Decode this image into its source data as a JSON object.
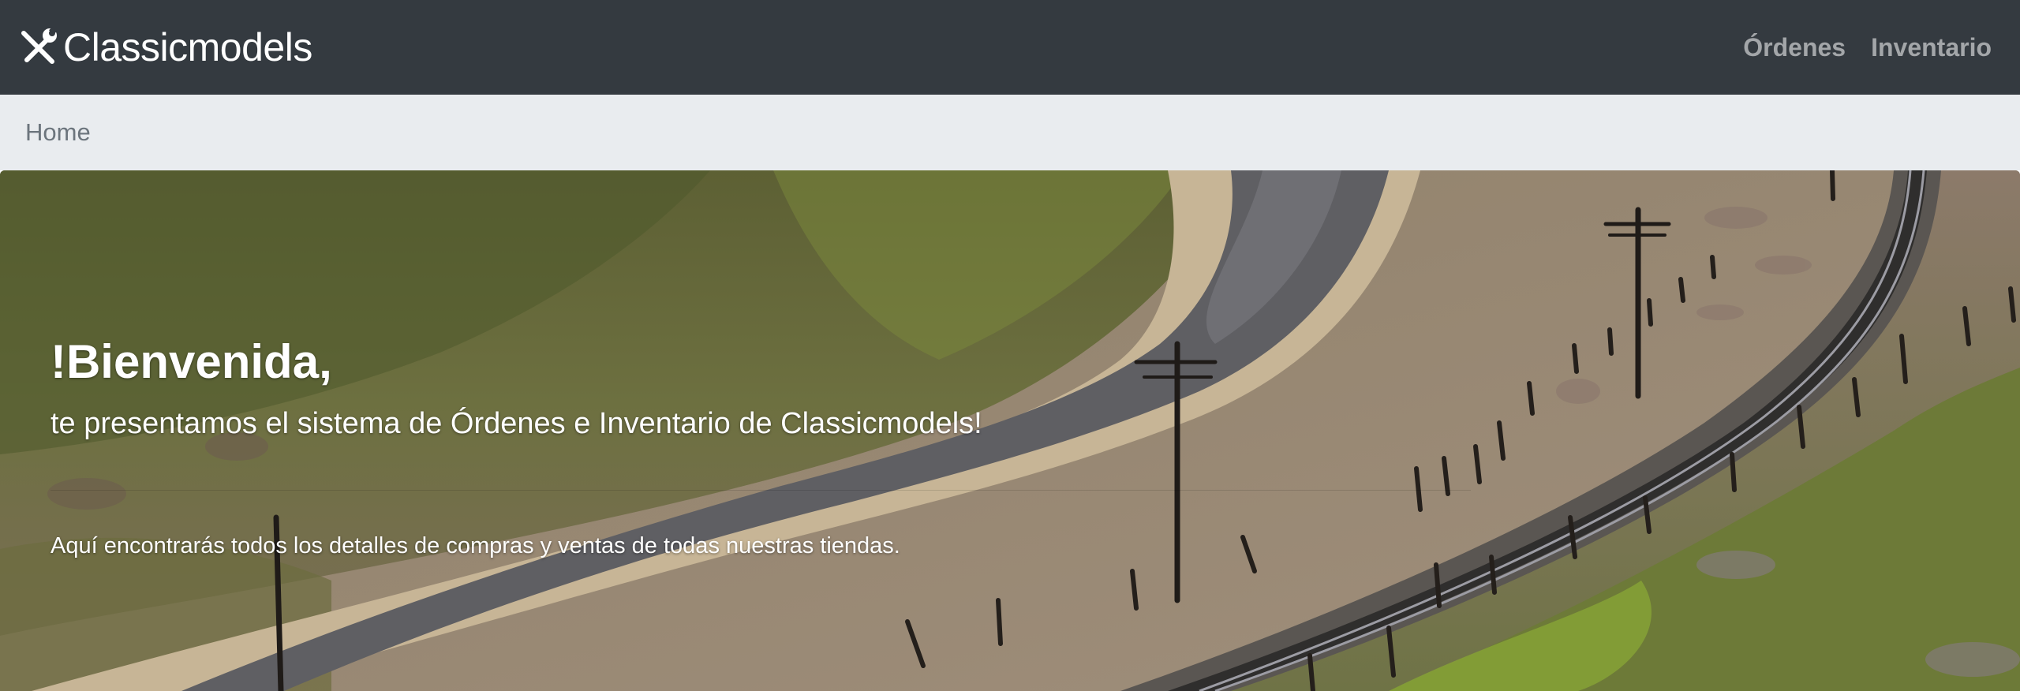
{
  "navbar": {
    "brand": "Classicmodels",
    "brand_icon": "tools-icon",
    "links": [
      {
        "label": "Órdenes"
      },
      {
        "label": "Inventario"
      }
    ]
  },
  "breadcrumb": {
    "items": [
      "Home"
    ]
  },
  "hero": {
    "title": "!Bienvenida,",
    "lead": "te presentamos el sistema de Órdenes e Inventario de Classicmodels!",
    "text": "Aquí encontrarás todos los detalles de compras y ventas de todas nuestras tiendas.",
    "background": "model railroad landscape with curved track, hillside and dirt road"
  },
  "colors": {
    "navbar_bg": "#343a40",
    "breadcrumb_bg": "#e9ecef",
    "nav_link": "rgba(255,255,255,0.55)"
  }
}
